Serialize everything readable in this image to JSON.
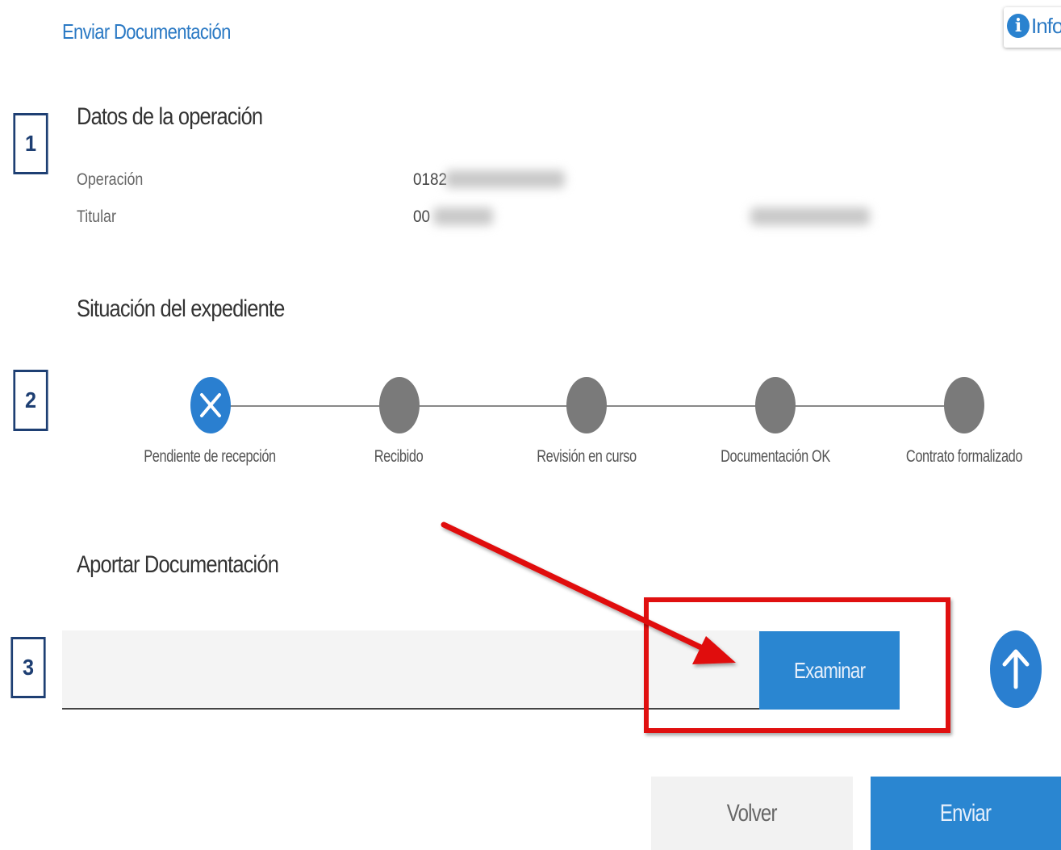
{
  "header": {
    "title": "Enviar Documentación",
    "info_label": "Info"
  },
  "steps": [
    "1",
    "2",
    "3"
  ],
  "operation": {
    "title": "Datos de la operación",
    "op_label": "Operación",
    "op_value": "0182",
    "holder_label": "Titular",
    "holder_value": "00"
  },
  "status": {
    "title": "Situación del expediente",
    "stages": [
      {
        "label": "Pendiente de recepción",
        "state": "active"
      },
      {
        "label": "Recibido",
        "state": "pending"
      },
      {
        "label": "Revisión en curso",
        "state": "pending"
      },
      {
        "label": "Documentación OK",
        "state": "pending"
      },
      {
        "label": "Contrato formalizado",
        "state": "pending"
      }
    ]
  },
  "upload": {
    "title": "Aportar Documentación",
    "browse_label": "Examinar"
  },
  "actions": {
    "back_label": "Volver",
    "send_label": "Enviar"
  },
  "colors": {
    "accent": "#2a86d1",
    "step_border": "#1e3f73",
    "annotation": "#e01010"
  },
  "icons": [
    "info-icon",
    "close-x-icon",
    "upload-arrow-icon",
    "annotation-arrow-icon"
  ]
}
